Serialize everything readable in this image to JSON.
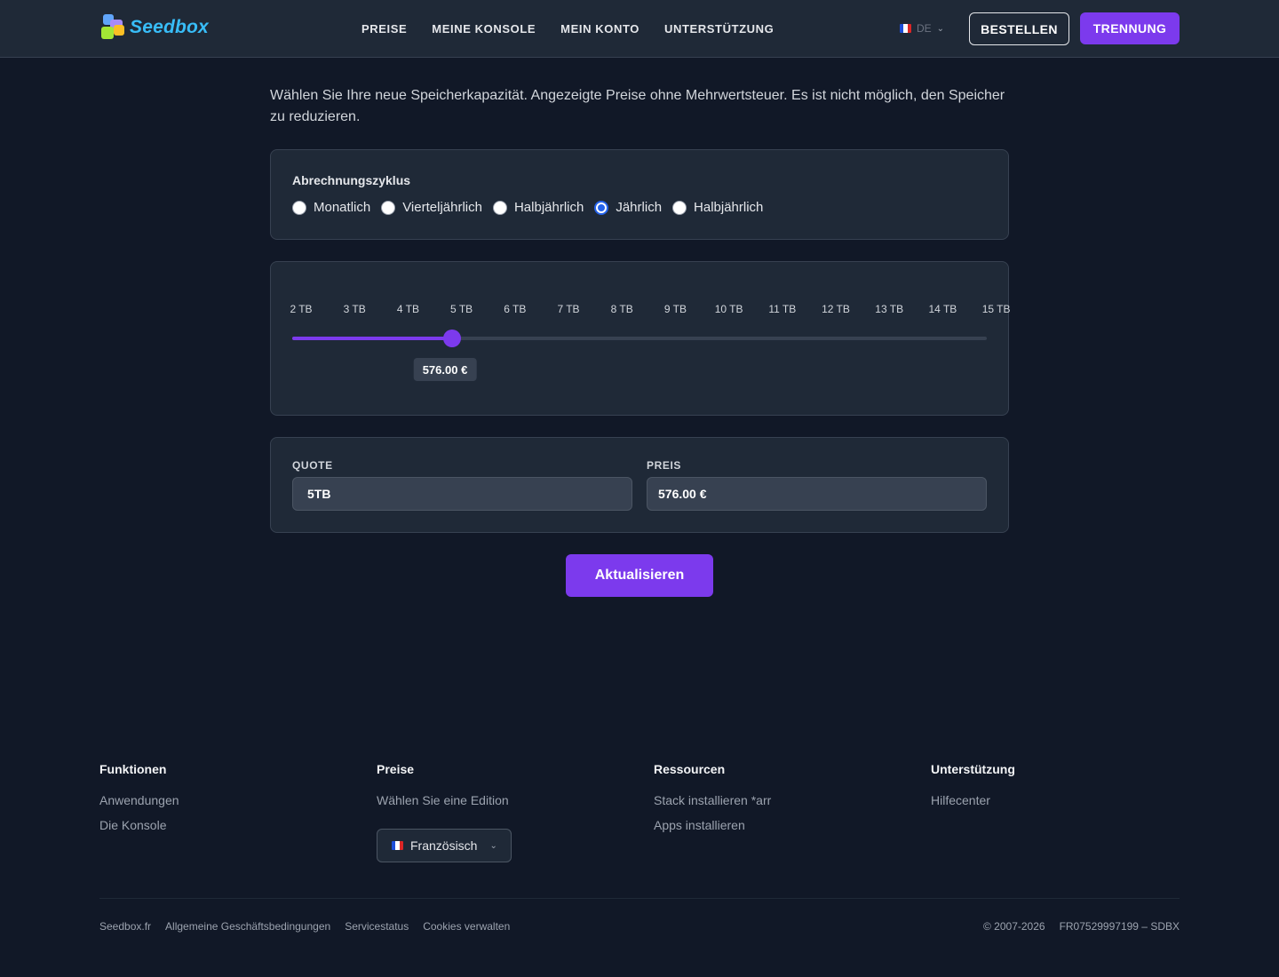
{
  "header": {
    "logo_text": "Seedbox",
    "nav": [
      "PREISE",
      "MEINE KONSOLE",
      "MEIN KONTO",
      "UNTERSTÜTZUNG"
    ],
    "language": "DE",
    "order_label": "BESTELLEN",
    "logout_label": "TRENNUNG"
  },
  "main": {
    "intro": "Wählen Sie Ihre neue Speicherkapazität. Angezeigte Preise ohne Mehrwertsteuer. Es ist nicht möglich, den Speicher zu reduzieren.",
    "billing": {
      "label": "Abrechnungszyklus",
      "options": [
        "Monatlich",
        "Vierteljährlich",
        "Halbjährlich",
        "Jährlich",
        "Halbjährlich"
      ],
      "selected_index": 3
    },
    "slider": {
      "ticks": [
        "2 TB",
        "3 TB",
        "4 TB",
        "5 TB",
        "6 TB",
        "7 TB",
        "8 TB",
        "9 TB",
        "10 TB",
        "11 TB",
        "12 TB",
        "13 TB",
        "14 TB",
        "15 TB"
      ],
      "selected_index": 3,
      "price_tooltip": "576.00 €"
    },
    "quota": {
      "quota_label": "QUOTE",
      "quota_value": "5TB",
      "price_label": "PREIS",
      "price_value": "576.00 €"
    },
    "update_label": "Aktualisieren"
  },
  "footer": {
    "columns": [
      {
        "title": "Funktionen",
        "links": [
          "Anwendungen",
          "Die Konsole"
        ]
      },
      {
        "title": "Preise",
        "links": [
          "Wählen Sie eine Edition"
        ]
      },
      {
        "title": "Ressourcen",
        "links": [
          "Stack installieren *arr",
          "Apps installieren"
        ]
      },
      {
        "title": "Unterstützung",
        "links": [
          "Hilfecenter"
        ]
      }
    ],
    "language_select": "Französisch",
    "bottom_links": [
      "Seedbox.fr",
      "Allgemeine Geschäftsbedingungen",
      "Servicestatus",
      "Cookies verwalten"
    ],
    "copyright": "© 2007-2026",
    "company_id": "FR07529997199 – SDBX"
  },
  "colors": {
    "accent": "#7c3aed",
    "background": "#111827",
    "panel": "#1f2937"
  }
}
